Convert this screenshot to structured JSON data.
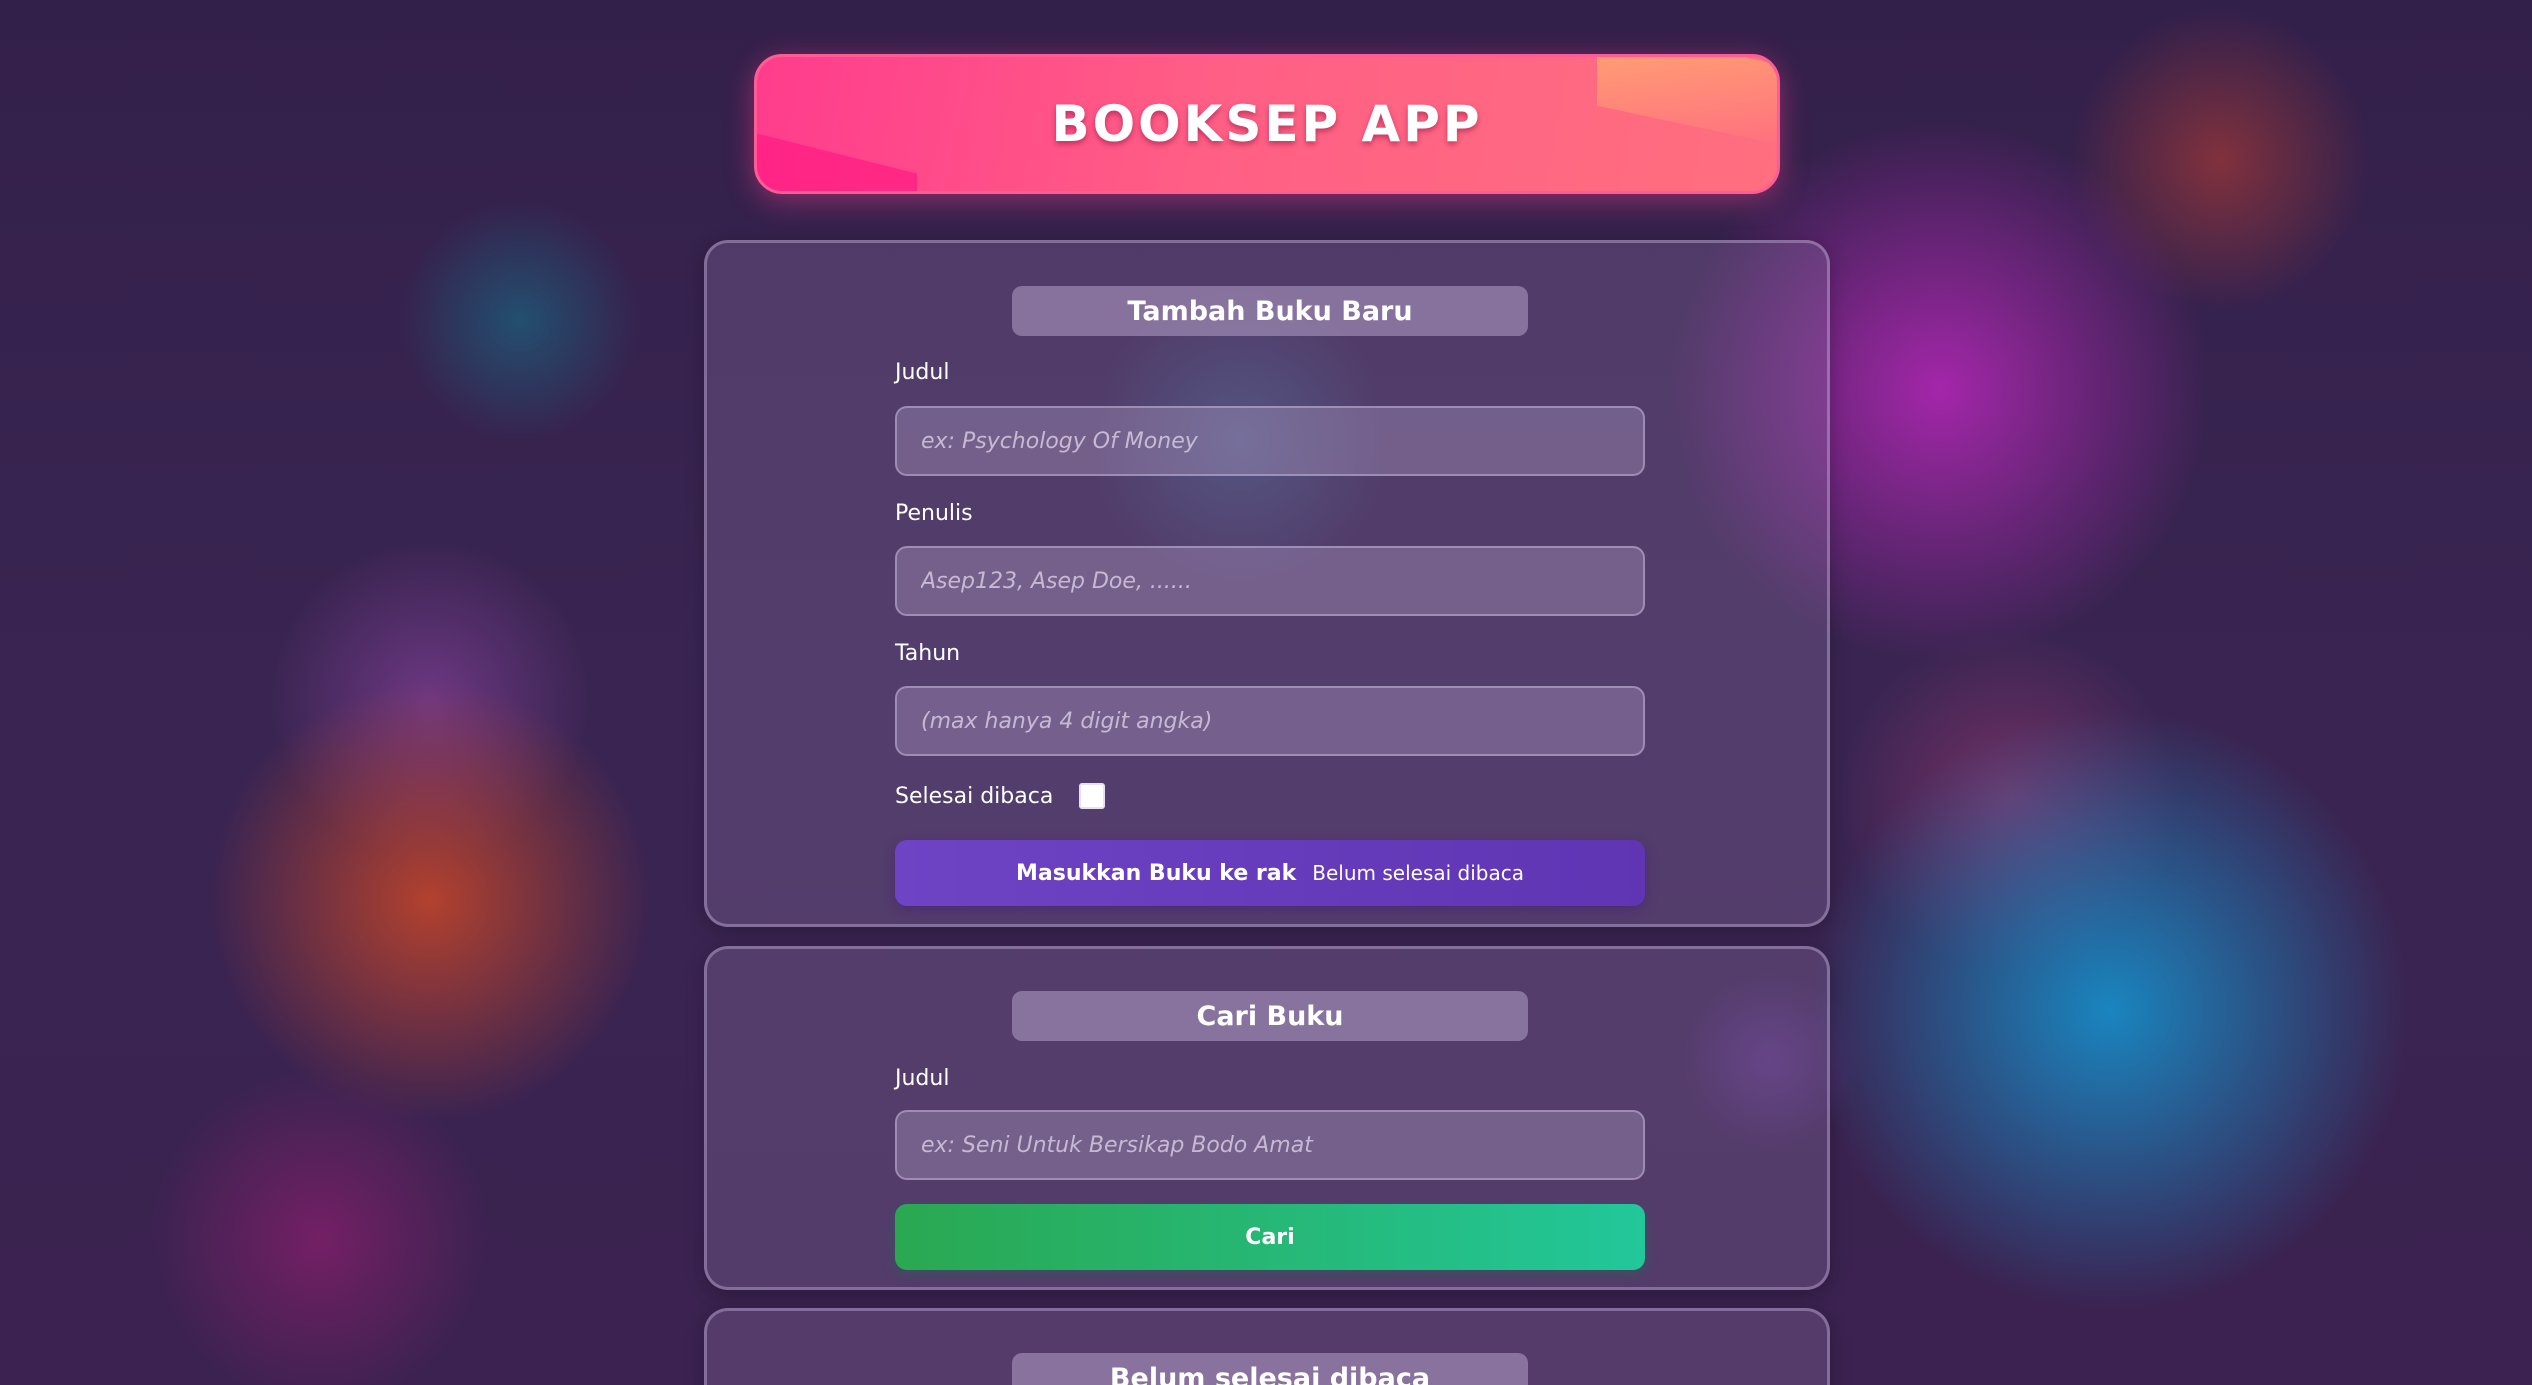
{
  "app": {
    "title": "BOOKSEP APP"
  },
  "add_book": {
    "heading": "Tambah Buku Baru",
    "title_label": "Judul",
    "title_placeholder": "ex: Psychology Of Money",
    "author_label": "Penulis",
    "author_placeholder": "Asep123, Asep Doe, ......",
    "year_label": "Tahun",
    "year_placeholder": "(max hanya 4 digit angka)",
    "complete_label": "Selesai dibaca",
    "complete_checked": false,
    "submit_label": "Masukkan Buku ke rak",
    "submit_shelf_label": "Belum selesai dibaca"
  },
  "search": {
    "heading": "Cari Buku",
    "title_label": "Judul",
    "title_placeholder": "ex: Seni Untuk Bersikap Bodo Amat",
    "button_label": "Cari"
  },
  "incomplete_shelf": {
    "heading": "Belum selesai dibaca"
  },
  "colors": {
    "header_accent": "#ff4f8b",
    "submit_button": "#6a3fc0",
    "search_button": "#26b46f",
    "background": "#3a2550"
  }
}
